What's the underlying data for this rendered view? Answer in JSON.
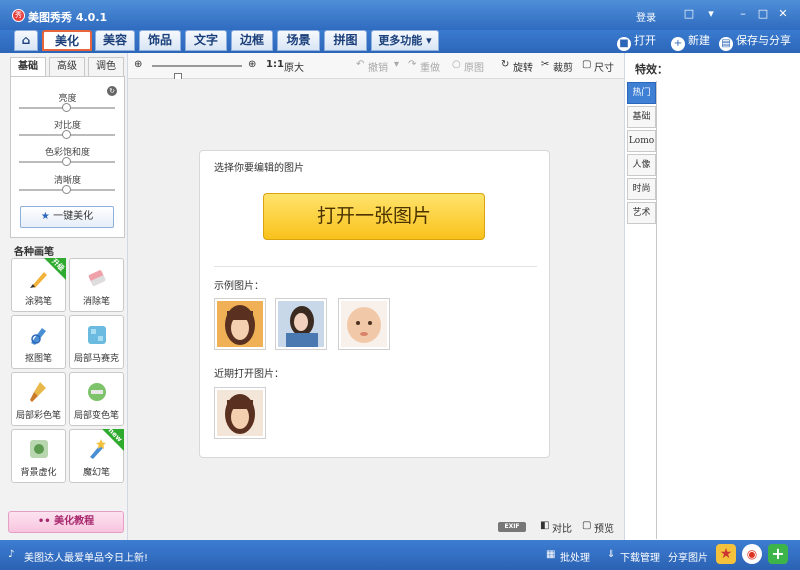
{
  "app": {
    "logo_glyph": "秀",
    "title": "美图秀秀 4.0.1"
  },
  "titlebar": {
    "login": "登录",
    "win_controls": [
      "chat-icon",
      "menu-icon",
      "minimize-icon",
      "maximize-icon",
      "close-icon"
    ]
  },
  "tabs": [
    {
      "label": "美化",
      "active": true
    },
    {
      "label": "美容"
    },
    {
      "label": "饰品"
    },
    {
      "label": "文字"
    },
    {
      "label": "边框"
    },
    {
      "label": "场景"
    },
    {
      "label": "拼图"
    },
    {
      "label": "更多功能"
    }
  ],
  "top_actions": {
    "open": "打开",
    "new": "新建",
    "save_share": "保存与分享"
  },
  "left": {
    "subtabs": [
      "基础",
      "高级",
      "调色"
    ],
    "sliders": [
      {
        "label": "亮度",
        "value": 0.5
      },
      {
        "label": "对比度",
        "value": 0.5
      },
      {
        "label": "色彩饱和度",
        "value": 0.5
      },
      {
        "label": "清晰度",
        "value": 0.5
      }
    ],
    "one_click": "一键美化",
    "brush_section": "各种画笔",
    "brushes": [
      {
        "label": "涂鸦笔",
        "badge": "升级"
      },
      {
        "label": "消除笔"
      },
      {
        "label": "抠图笔"
      },
      {
        "label": "局部马赛克"
      },
      {
        "label": "局部彩色笔"
      },
      {
        "label": "局部变色笔"
      },
      {
        "label": "背景虚化"
      },
      {
        "label": "魔幻笔",
        "badge": "new"
      }
    ],
    "tutorial": "美化教程"
  },
  "toolbar": {
    "zoom_label": "1:1",
    "original": "原大",
    "undo": "撤销",
    "redo": "重做",
    "original_img": "原图",
    "rotate": "旋转",
    "crop": "裁剪",
    "size": "尺寸"
  },
  "canvas": {
    "prompt": "选择你要编辑的图片",
    "open_button": "打开一张图片",
    "examples_label": "示例图片：",
    "recent_label": "近期打开图片："
  },
  "canvas_bottom": {
    "exif": "EXIF",
    "compare": "对比",
    "preview": "预览"
  },
  "effects": {
    "title": "特效：",
    "items": [
      {
        "label": "热门",
        "active": true
      },
      {
        "label": "基础"
      },
      {
        "label": "Lomo"
      },
      {
        "label": "人像"
      },
      {
        "label": "时尚"
      },
      {
        "label": "艺术"
      }
    ]
  },
  "statusbar": {
    "news": "美图达人最爱单品今日上新!",
    "batch": "批处理",
    "download": "下载管理",
    "share": "分享图片"
  },
  "colors": {
    "accent": "#2c66b8",
    "highlight": "#e8643a",
    "button_yellow": "#f9c21c"
  }
}
